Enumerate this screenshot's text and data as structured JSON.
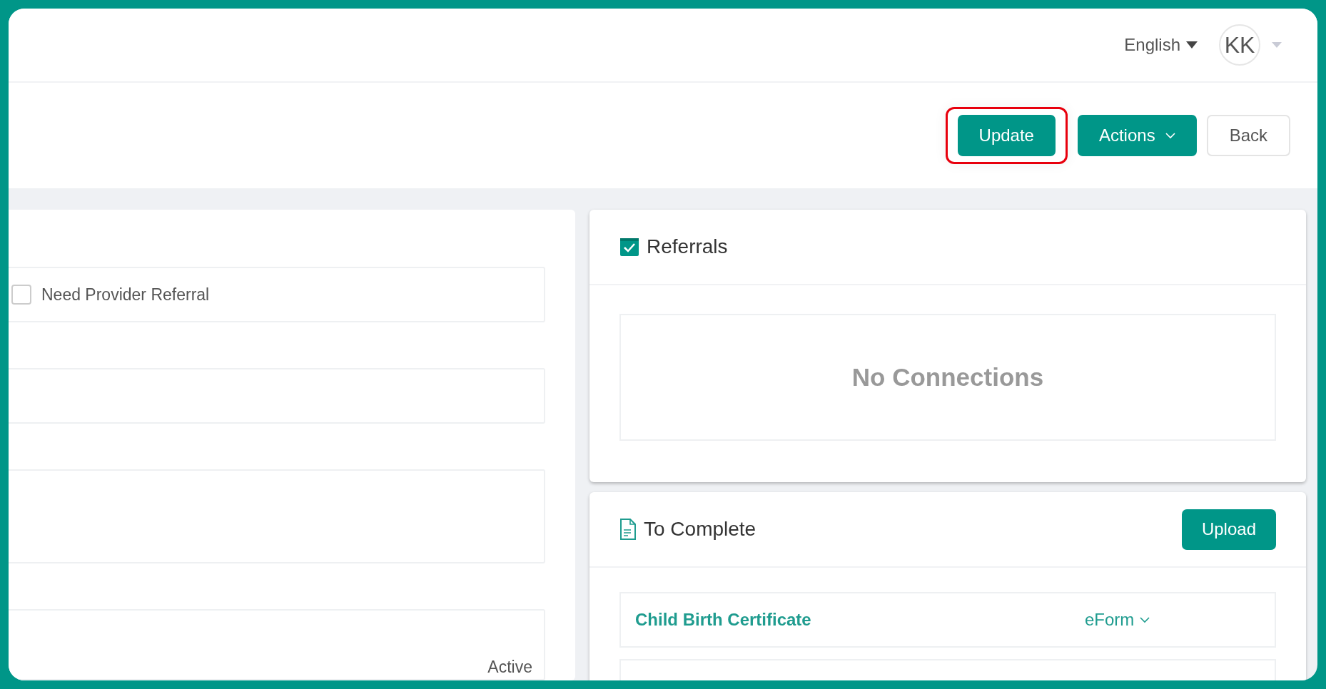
{
  "header": {
    "language": "English",
    "avatar_initials": "KK"
  },
  "toolbar": {
    "buttons": [
      {
        "label": "Update",
        "kind": "primary",
        "highlighted": true
      },
      {
        "label": "Actions",
        "kind": "dropdown",
        "highlighted": false
      },
      {
        "label": "Back",
        "kind": "outline",
        "highlighted": false
      }
    ]
  },
  "form": {
    "fields": [
      {
        "kind": "checkbox",
        "label": "Need Provider Referral",
        "checked": false
      },
      {
        "kind": "input"
      },
      {
        "kind": "textarea"
      },
      {
        "kind": "status",
        "value": "Active"
      }
    ]
  },
  "referrals": {
    "title": "Referrals",
    "empty_text": "No Connections"
  },
  "to_complete": {
    "title": "To Complete",
    "upload_label": "Upload",
    "items": [
      {
        "name": "Child Birth Certificate",
        "type": "eForm"
      }
    ]
  }
}
